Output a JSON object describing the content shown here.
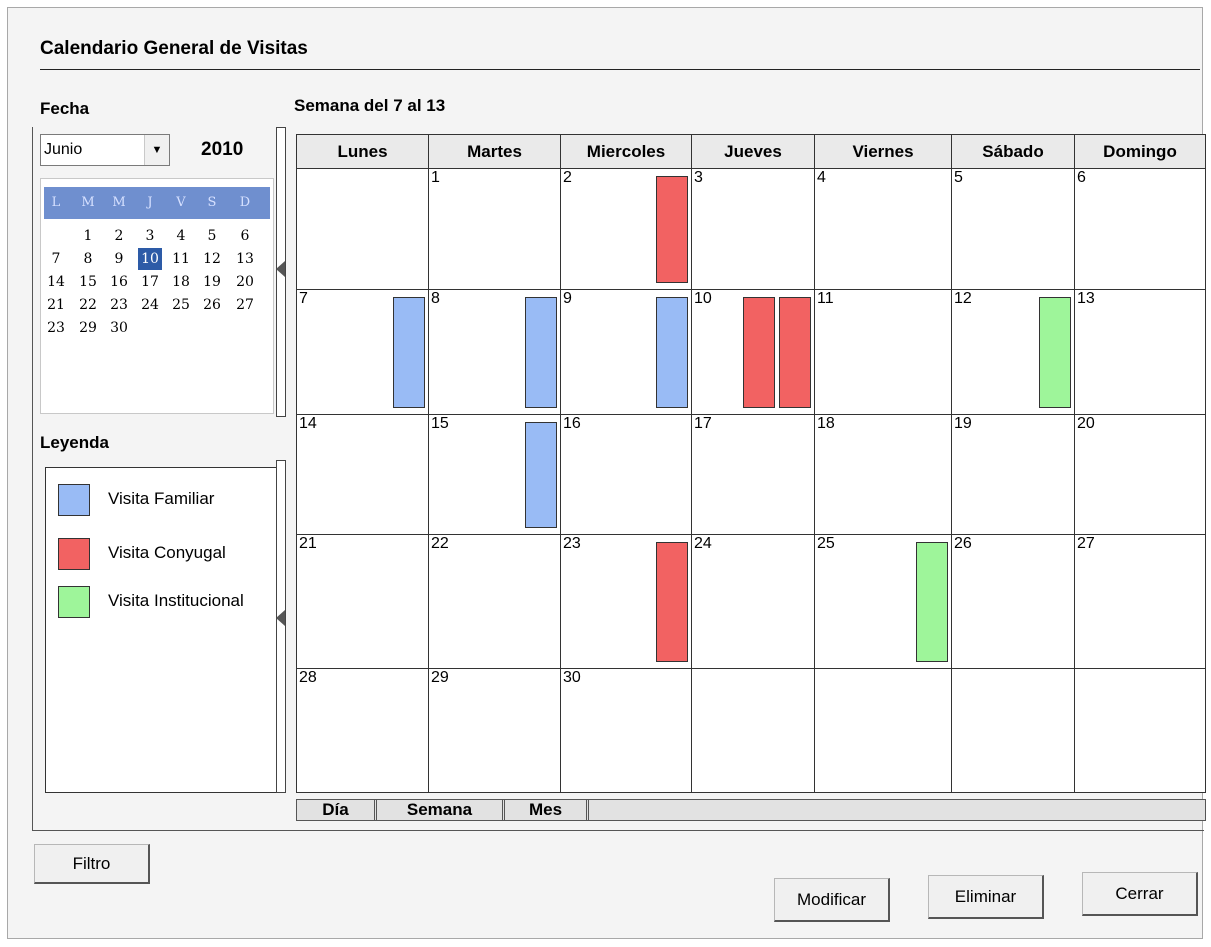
{
  "title": "Calendario General  de Visitas",
  "fecha": {
    "label": "Fecha",
    "month": "Junio",
    "year": "2010",
    "weekday_headers": [
      "L",
      "M",
      "M",
      "J",
      "V",
      "S",
      "D"
    ],
    "days": [
      "1",
      "2",
      "3",
      "4",
      "5",
      "6",
      "7",
      "8",
      "9",
      "10",
      "11",
      "12",
      "13",
      "14",
      "15",
      "16",
      "17",
      "18",
      "19",
      "20",
      "21",
      "22",
      "23",
      "24",
      "25",
      "26",
      "27",
      "23",
      "29",
      "30"
    ],
    "selected_day": "10"
  },
  "legend": {
    "label": "Leyenda",
    "items": [
      {
        "label": "Visita Familiar",
        "color": "#99bbf5"
      },
      {
        "label": "Visita Conyugal",
        "color": "#f26262"
      },
      {
        "label": "Visita Institucional",
        "color": "#9ef59a"
      }
    ]
  },
  "calendar": {
    "week_label": "Semana del 7 al 13",
    "day_headers": [
      "Lunes",
      "Martes",
      "Miercoles",
      "Jueves",
      "Viernes",
      "Sábado",
      "Domingo"
    ],
    "weeks": [
      [
        "",
        "1",
        "2",
        "3",
        "4",
        "5",
        "6"
      ],
      [
        "7",
        "8",
        "9",
        "10",
        "11",
        "12",
        "13"
      ],
      [
        "14",
        "15",
        "16",
        "17",
        "18",
        "19",
        "20"
      ],
      [
        "21",
        "22",
        "23",
        "24",
        "25",
        "26",
        "27"
      ],
      [
        "28",
        "29",
        "30",
        "",
        "",
        "",
        ""
      ]
    ],
    "events": [
      {
        "day": "2",
        "type": "Visita Conyugal"
      },
      {
        "day": "7",
        "type": "Visita Familiar"
      },
      {
        "day": "8",
        "type": "Visita Familiar"
      },
      {
        "day": "9",
        "type": "Visita Familiar"
      },
      {
        "day": "10",
        "type": "Visita Conyugal"
      },
      {
        "day": "10",
        "type": "Visita Conyugal"
      },
      {
        "day": "12",
        "type": "Visita Institucional"
      },
      {
        "day": "15",
        "type": "Visita Familiar"
      },
      {
        "day": "23",
        "type": "Visita Conyugal"
      },
      {
        "day": "25",
        "type": "Visita Institucional"
      }
    ]
  },
  "view_tabs": [
    "Día",
    "Semana",
    "Mes"
  ],
  "buttons": {
    "filter": "Filtro",
    "modify": "Modificar",
    "delete": "Eliminar",
    "close": "Cerrar"
  }
}
